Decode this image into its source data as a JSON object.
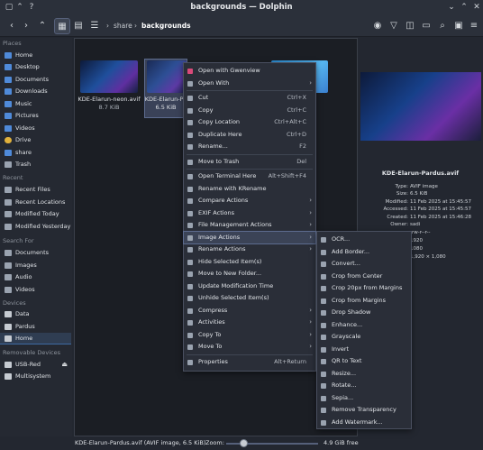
{
  "window": {
    "title": "backgrounds — Dolphin"
  },
  "toolbar": {
    "crumbs": [
      "share",
      "backgrounds"
    ]
  },
  "sidebar": {
    "places_heading": "Places",
    "places": [
      "Home",
      "Desktop",
      "Documents",
      "Downloads",
      "Music",
      "Pictures",
      "Videos",
      "Drive",
      "share",
      "Trash"
    ],
    "recent_heading": "Recent",
    "recent": [
      "Recent Files",
      "Recent Locations",
      "Modified Today",
      "Modified Yesterday"
    ],
    "search_heading": "Search For",
    "search": [
      "Documents",
      "Images",
      "Audio",
      "Videos"
    ],
    "devices_heading": "Devices",
    "devices": [
      "Data",
      "Pardus",
      "Home"
    ],
    "removable_heading": "Removable Devices",
    "removable": [
      "USB-Red",
      "Multisystem"
    ]
  },
  "files": [
    {
      "name": "KDE-Elarun-neon.avif",
      "size": "8.7 KiB"
    },
    {
      "name": "KDE-Elarun-Pa",
      "size": "6.5 KiB"
    }
  ],
  "preview": {
    "filename": "KDE-Elarun-Pardus.avif",
    "rows": [
      {
        "k": "Type:",
        "v": "AVIF image"
      },
      {
        "k": "Size:",
        "v": "6.5 KiB"
      },
      {
        "k": "Modified:",
        "v": "11 Feb 2025 at 15:45:57"
      },
      {
        "k": "Accessed:",
        "v": "11 Feb 2025 at 15:45:57"
      },
      {
        "k": "Created:",
        "v": "11 Feb 2025 at 15:46:28"
      },
      {
        "k": "Owner:",
        "v": "sadi"
      }
    ],
    "extra": [
      "-rw-r--r--",
      "1920",
      "1080",
      "1,920 × 1,080"
    ]
  },
  "context_menu": {
    "items": [
      {
        "label": "Open with Gwenview",
        "shortcut": "",
        "arrow": false
      },
      {
        "label": "Open With",
        "shortcut": "",
        "arrow": true
      },
      {
        "sep": true
      },
      {
        "label": "Cut",
        "shortcut": "Ctrl+X",
        "arrow": false
      },
      {
        "label": "Copy",
        "shortcut": "Ctrl+C",
        "arrow": false
      },
      {
        "label": "Copy Location",
        "shortcut": "Ctrl+Alt+C",
        "arrow": false
      },
      {
        "label": "Duplicate Here",
        "shortcut": "Ctrl+D",
        "arrow": false
      },
      {
        "label": "Rename...",
        "shortcut": "F2",
        "arrow": false
      },
      {
        "sep": true
      },
      {
        "label": "Move to Trash",
        "shortcut": "Del",
        "arrow": false
      },
      {
        "sep": true
      },
      {
        "label": "Open Terminal Here",
        "shortcut": "Alt+Shift+F4",
        "arrow": false
      },
      {
        "label": "Rename with KRename",
        "shortcut": "",
        "arrow": false
      },
      {
        "label": "Compare Actions",
        "shortcut": "",
        "arrow": true
      },
      {
        "label": "EXIF Actions",
        "shortcut": "",
        "arrow": true
      },
      {
        "label": "File Management Actions",
        "shortcut": "",
        "arrow": true
      },
      {
        "label": "Image Actions",
        "shortcut": "",
        "arrow": true
      },
      {
        "label": "Rename Actions",
        "shortcut": "",
        "arrow": true
      },
      {
        "label": "Hide Selected Item(s)",
        "shortcut": "",
        "arrow": false
      },
      {
        "label": "Move to New Folder...",
        "shortcut": "",
        "arrow": false
      },
      {
        "label": "Update Modification Time",
        "shortcut": "",
        "arrow": false
      },
      {
        "label": "Unhide Selected Item(s)",
        "shortcut": "",
        "arrow": false
      },
      {
        "label": "Compress",
        "shortcut": "",
        "arrow": true
      },
      {
        "label": "Activities",
        "shortcut": "",
        "arrow": true
      },
      {
        "label": "Copy To",
        "shortcut": "",
        "arrow": true
      },
      {
        "label": "Move To",
        "shortcut": "",
        "arrow": true
      },
      {
        "sep": true
      },
      {
        "label": "Properties",
        "shortcut": "Alt+Return",
        "arrow": false
      }
    ]
  },
  "submenu": {
    "items": [
      "OCR...",
      "Add Border...",
      "Convert...",
      "Crop from Center",
      "Crop 20px from Margins",
      "Crop from Margins",
      "Drop Shadow",
      "Enhance...",
      "Grayscale",
      "Invert",
      "QR to Text",
      "Resize...",
      "Rotate...",
      "Sepia...",
      "Remove Transparency",
      "Add Watermark..."
    ]
  },
  "statusbar": {
    "text": "KDE-Elarun-Pardus.avif (AVIF image, 6.5 KiB)",
    "zoom": "Zoom:",
    "free": "4.9 GiB free"
  },
  "colors": {
    "accent": "#3d6aa3",
    "highlight": "#3b4356"
  }
}
